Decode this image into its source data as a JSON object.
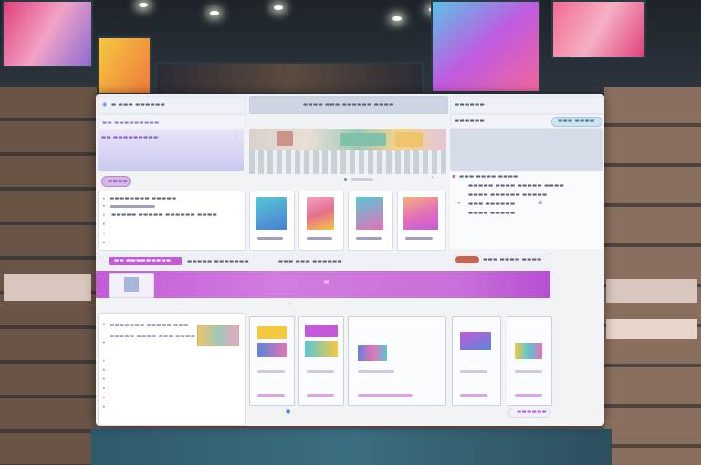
{
  "colors": {
    "accent_purple": "#c35bd8",
    "accent_lavender": "#c9c2ee",
    "accent_teal": "#59c6d6",
    "accent_pink": "#e472b6",
    "accent_blue": "#5a86d6",
    "header_gray": "#cfd5e2"
  },
  "header": {
    "left_title": "▬ ▬▬▬ ▬▬▬▬▬▬",
    "center_title": "▬▬▬▬ ▬▬▬ ▬▬▬▬▬▬ ▬▬▬▬",
    "right_title": "▬▬▬▬▬▬",
    "right_button": "▬▬▬ ▬▬▬▬"
  },
  "left_panel": {
    "section_title": "▬▬ ▬▬▬▬▬▬▬▬▬",
    "filter_button": "▬▬▬▬",
    "list_items": [
      "▬▬▬▬▬▬▬▬ ▬▬▬▬▬",
      "▬▬▬▬▬ ▬▬▬▬▬ ▬▬▬▬▬▬ ▬▬▬▬",
      "▬▬▬▬▬▬ ▬▬ ▬▬▬▬▬",
      "▬▬▬"
    ]
  },
  "right_panel": {
    "list_items": [
      "▬▬▬ ▬▬▬▬ ▬▬▬▬",
      "▬▬▬▬▬ ▬▬▬▬ ▬▬▬▬▬ ▬▬▬▬",
      "▬▬▬▬ ▬▬▬▬▬▬ ▬▬▬▬▬",
      "▬▬▬ ▬▬▬▬▬▬",
      "▬▬▬▬ ▬▬▬▬▬"
    ]
  },
  "banner": {
    "tab_1": "▬▬ ▬▬▬▬▬▬▬▬▬",
    "tab_2": "▬▬▬▬▬ ▬▬▬▬▬▬▬",
    "tab_3": "▬▬▬ ▬▬▬ ▬▬▬▬▬▬",
    "link": "▬▬▬ ▬▬▬▬ ▬▬▬▬"
  },
  "lower_left": {
    "title": "▬▬▬▬▬▬▬ ▬▬▬▬▬ ▬▬▬",
    "line": "▬▬▬▬▬ ▬▬▬▬ ▬▬▬ ▬▬▬▬"
  },
  "footer": {
    "button": "▬▬▬▬▬▬"
  }
}
